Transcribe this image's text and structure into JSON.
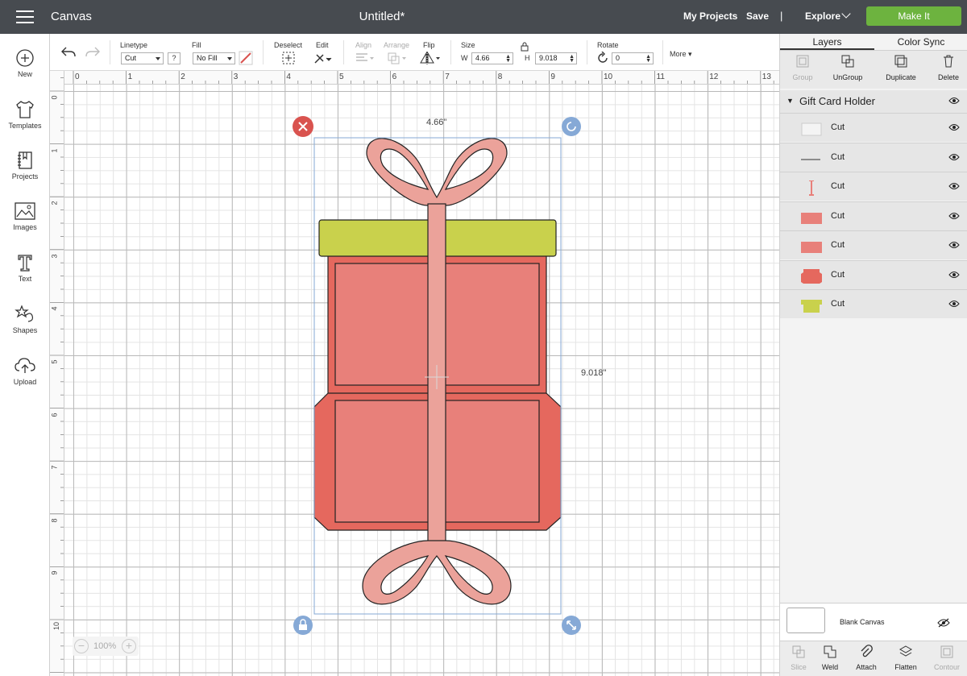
{
  "topbar": {
    "app_name": "Canvas",
    "document_title": "Untitled*",
    "my_projects": "My Projects",
    "save": "Save",
    "separator": "|",
    "explore": "Explore",
    "make_it": "Make It",
    "make_it_color": "#6db33f"
  },
  "sidebar": {
    "items": [
      {
        "label": "New",
        "icon": "plus-circle-icon"
      },
      {
        "label": "Templates",
        "icon": "tshirt-icon"
      },
      {
        "label": "Projects",
        "icon": "notebook-icon"
      },
      {
        "label": "Images",
        "icon": "image-icon"
      },
      {
        "label": "Text",
        "icon": "text-t-icon"
      },
      {
        "label": "Shapes",
        "icon": "shapes-icon"
      },
      {
        "label": "Upload",
        "icon": "cloud-upload-icon"
      }
    ]
  },
  "toolbar": {
    "linetype_label": "Linetype",
    "linetype_value": "Cut",
    "help": "?",
    "fill_label": "Fill",
    "fill_value": "No Fill",
    "deselect_label": "Deselect",
    "edit_label": "Edit",
    "align_label": "Align",
    "arrange_label": "Arrange",
    "flip_label": "Flip",
    "size_label": "Size",
    "w_label": "W",
    "w_value": "4.66",
    "h_label": "H",
    "h_value": "9.018",
    "rotate_label": "Rotate",
    "rotate_value": "0",
    "more_label": "More"
  },
  "rulers": {
    "horizontal": [
      "0",
      "1",
      "2",
      "3",
      "4",
      "5",
      "6",
      "7",
      "8",
      "9",
      "10",
      "11",
      "12",
      "13"
    ],
    "vertical": [
      "0",
      "1",
      "2",
      "3",
      "4",
      "5",
      "6",
      "7",
      "8",
      "9",
      "10"
    ]
  },
  "canvas": {
    "width_readout": "4.66\"",
    "height_readout": "9.018\"",
    "zoom_minus": "−",
    "zoom_value": "100%",
    "zoom_plus": "+",
    "colors": {
      "box": "#e5685e",
      "panel": "#e8807a",
      "ribbon": "#eba29a",
      "lid": "#c9d14c",
      "selection": "#86a9d6",
      "delete_handle": "#d9534f"
    }
  },
  "layers_panel": {
    "tabs": [
      "Layers",
      "Color Sync"
    ],
    "actions": [
      {
        "label": "Group",
        "enabled": false
      },
      {
        "label": "UnGroup",
        "enabled": true
      },
      {
        "label": "Duplicate",
        "enabled": true
      },
      {
        "label": "Delete",
        "enabled": true
      }
    ],
    "group_name": "Gift Card Holder",
    "layers": [
      {
        "label": "Cut",
        "thumb": "blank"
      },
      {
        "label": "Cut",
        "thumb": "line"
      },
      {
        "label": "Cut",
        "thumb": "ribbon"
      },
      {
        "label": "Cut",
        "thumb": "panel"
      },
      {
        "label": "Cut",
        "thumb": "panel"
      },
      {
        "label": "Cut",
        "thumb": "box"
      },
      {
        "label": "Cut",
        "thumb": "lid"
      }
    ],
    "blank_canvas": "Blank Canvas",
    "bottom_actions": [
      {
        "label": "Slice",
        "enabled": false
      },
      {
        "label": "Weld",
        "enabled": true
      },
      {
        "label": "Attach",
        "enabled": true
      },
      {
        "label": "Flatten",
        "enabled": true
      },
      {
        "label": "Contour",
        "enabled": false
      }
    ]
  }
}
